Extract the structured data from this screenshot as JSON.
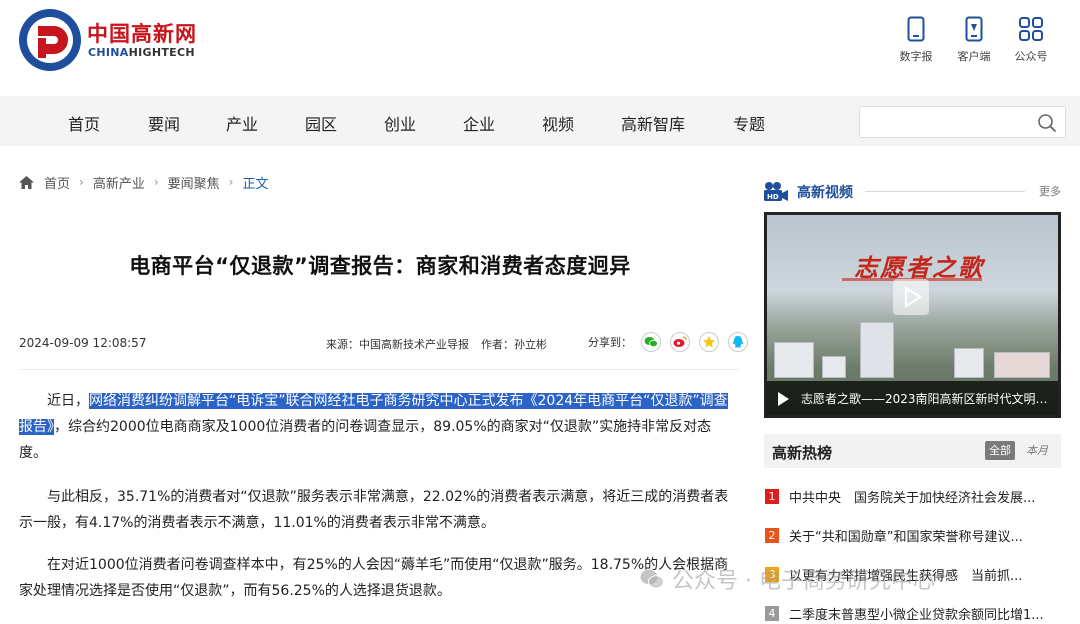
{
  "header": {
    "logo_cn": "中国高新网",
    "logo_en_1": "CHINA",
    "logo_en_2": "HIGHTECH",
    "links": [
      {
        "label": "数字报",
        "icon": "mobile-phone-icon"
      },
      {
        "label": "客户端",
        "icon": "app-phone-icon"
      },
      {
        "label": "公众号",
        "icon": "grid-apps-icon"
      }
    ]
  },
  "nav": {
    "items": [
      "首页",
      "要闻",
      "产业",
      "园区",
      "创业",
      "企业",
      "视频",
      "高新智库",
      "专题"
    ],
    "search_placeholder": ""
  },
  "breadcrumb": [
    "首页",
    "高新产业",
    "要闻聚焦",
    "正文"
  ],
  "article": {
    "title": "电商平台“仅退款”调查报告：商家和消费者态度迥异",
    "date": "2024-09-09 12:08:57",
    "source_label": "来源：中国高新技术产业导报",
    "author_label": "作者：孙立彬",
    "share_label": "分享到：",
    "p1_lead": "近日，",
    "p1_highlight": "网络消费纠纷调解平台“电诉宝”联合网经社电子商务研究中心正式发布《2024年电商平台“仅退款”调查报告》",
    "p1_rest": "，综合约2000位电商商家及1000位消费者的问卷调查显示，89.05%的商家对“仅退款”实施持非常反对态度。",
    "p2": "与此相反，35.71%的消费者对“仅退款”服务表示非常满意，22.02%的消费者表示满意，将近三成的消费者表示一般，有4.17%的消费者表示不满意，11.01%的消费者表示非常不满意。",
    "p3": "在对近1000位消费者问卷调查样本中，有25%的人会因“薅羊毛”而使用“仅退款”服务。18.75%的人会根据商家处理情况选择是否使用“仅退款”，而有56.25%的人选择退货退款。"
  },
  "sidebar": {
    "video_section": {
      "title": "高新视频",
      "more": "更多",
      "poster_text": "志愿者之歌",
      "caption": "志愿者之歌——2023南阳高新区新时代文明实..."
    },
    "hot": {
      "title": "高新热榜",
      "tab_all": "全部",
      "tab_month": "本月",
      "items": [
        {
          "rank": "1",
          "color": "#d9201c",
          "text": "中共中央　国务院关于加快经济社会发展..."
        },
        {
          "rank": "2",
          "color": "#e8531a",
          "text": "关于“共和国勋章”和国家荣誉称号建议..."
        },
        {
          "rank": "3",
          "color": "#f0a21b",
          "text": "以更有力举措增强民生获得感　当前抓..."
        },
        {
          "rank": "4",
          "color": "#9a9a9a",
          "text": "二季度末普惠型小微企业贷款余额同比增1..."
        }
      ]
    }
  },
  "watermark": "公众号 · 电子商务研究中心"
}
